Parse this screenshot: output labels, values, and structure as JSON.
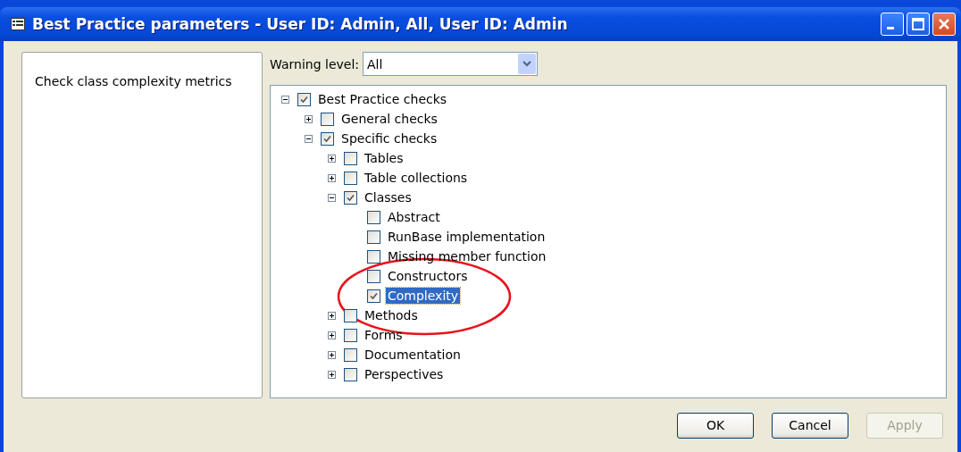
{
  "window": {
    "title": "Best Practice parameters - User ID: Admin, All, User ID: Admin"
  },
  "description": "Check class complexity metrics",
  "warning_level": {
    "label": "Warning level:",
    "value": "All"
  },
  "tree": [
    {
      "label": "Best Practice checks",
      "checked": true,
      "expanded": true,
      "selected": false,
      "children": [
        {
          "label": "General checks",
          "checked": false,
          "expanded": false,
          "selected": false
        },
        {
          "label": "Specific checks",
          "checked": true,
          "expanded": true,
          "selected": false,
          "children": [
            {
              "label": "Tables",
              "checked": false,
              "expanded": false,
              "selected": false
            },
            {
              "label": "Table collections",
              "checked": false,
              "expanded": false,
              "selected": false
            },
            {
              "label": "Classes",
              "checked": true,
              "expanded": true,
              "selected": false,
              "children": [
                {
                  "label": "Abstract",
                  "checked": false,
                  "selected": false
                },
                {
                  "label": "RunBase implementation",
                  "checked": false,
                  "selected": false
                },
                {
                  "label": "Missing member function",
                  "checked": false,
                  "selected": false
                },
                {
                  "label": "Constructors",
                  "checked": false,
                  "selected": false
                },
                {
                  "label": "Complexity",
                  "checked": true,
                  "selected": true
                }
              ]
            },
            {
              "label": "Methods",
              "checked": false,
              "expanded": false,
              "selected": false
            },
            {
              "label": "Forms",
              "checked": false,
              "expanded": false,
              "selected": false
            },
            {
              "label": "Documentation",
              "checked": false,
              "expanded": false,
              "selected": false
            },
            {
              "label": "Perspectives",
              "checked": false,
              "expanded": false,
              "selected": false
            }
          ]
        }
      ]
    }
  ],
  "buttons": [
    {
      "label": "OK",
      "disabled": false
    },
    {
      "label": "Cancel",
      "disabled": false
    },
    {
      "label": "Apply",
      "disabled": true
    }
  ]
}
